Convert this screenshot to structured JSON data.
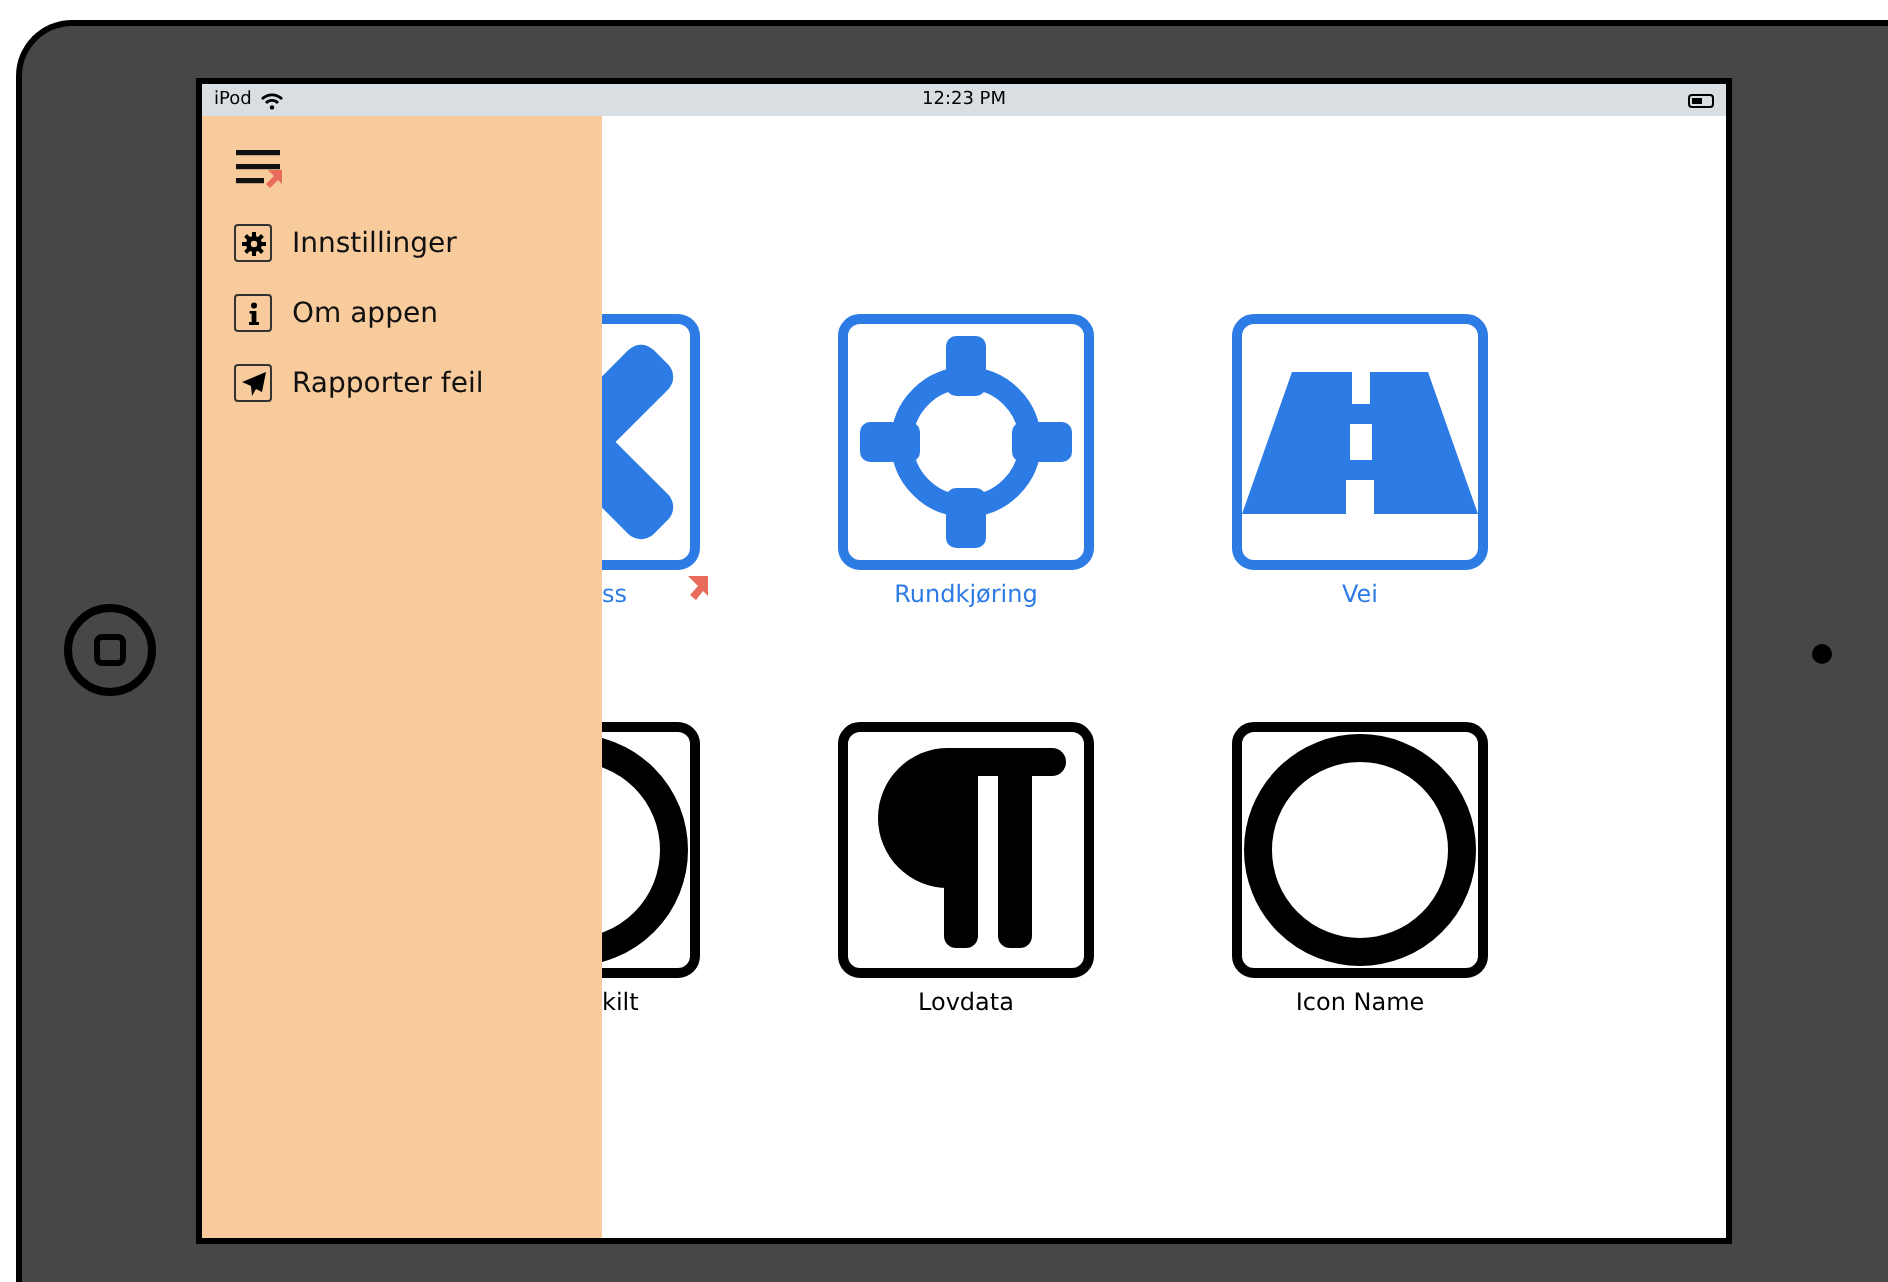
{
  "status_bar": {
    "carrier": "iPod",
    "time": "12:23 PM"
  },
  "drawer": {
    "items": [
      {
        "label": "Innstillinger",
        "kind": "gear"
      },
      {
        "label": "Om appen",
        "kind": "info"
      },
      {
        "label": "Rapporter feil",
        "kind": "send"
      }
    ]
  },
  "tiles": [
    {
      "label": "ss",
      "kind": "cross",
      "color": "#2d7be5",
      "linked": true
    },
    {
      "label": "Rundkjøring",
      "kind": "roundabout",
      "color": "#2d7be5",
      "linked": false
    },
    {
      "label": "Vei",
      "kind": "road",
      "color": "#2d7be5",
      "linked": false
    },
    {
      "label": "kilt",
      "kind": "ring",
      "color": "#000000",
      "linked": false
    },
    {
      "label": "Lovdata",
      "kind": "paragraph",
      "color": "#000000",
      "linked": false
    },
    {
      "label": "Icon Name",
      "kind": "ring",
      "color": "#000000",
      "linked": false
    }
  ]
}
